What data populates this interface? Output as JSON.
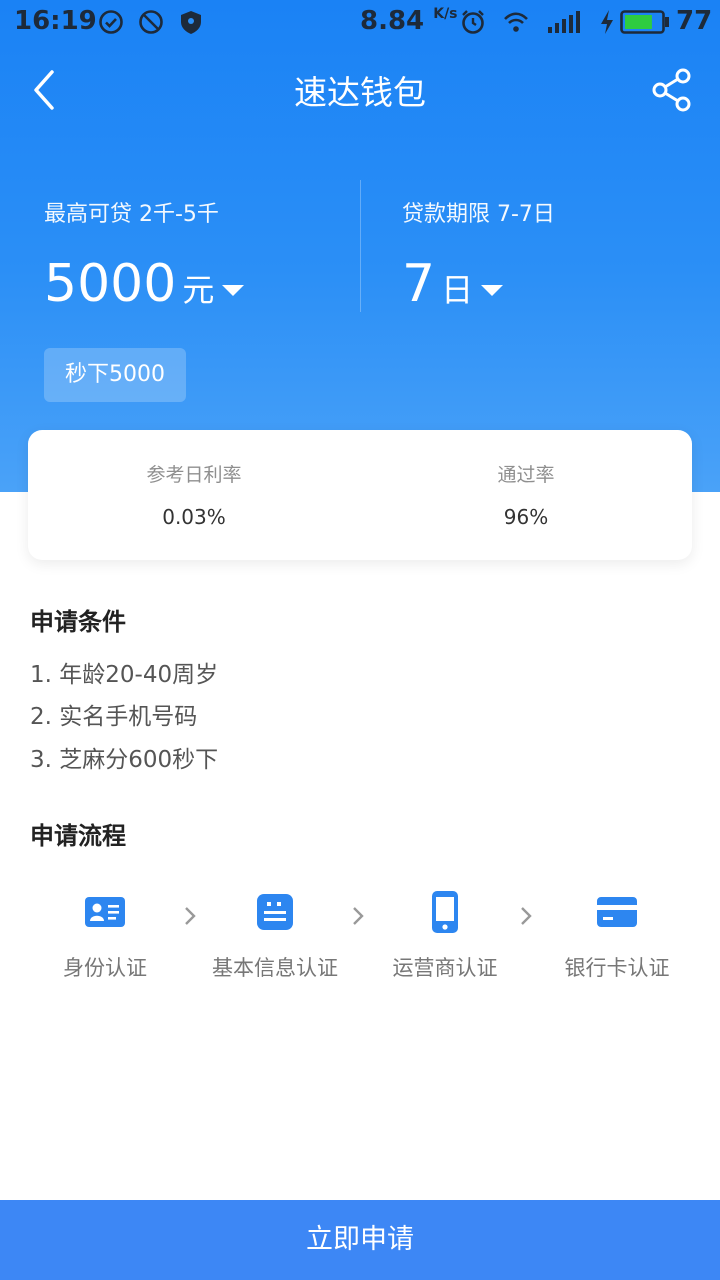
{
  "status_bar": {
    "time": "16:19",
    "speed_value": "8.84",
    "speed_unit": "K/s",
    "battery_level": "77",
    "icons": [
      "check-circle-icon",
      "no-entry-icon",
      "shield-icon",
      "alarm-icon",
      "wifi-icon",
      "signal-4g-icon",
      "charging-icon",
      "battery-icon"
    ]
  },
  "nav": {
    "title": "速达钱包",
    "back_icon": "chevron-left-icon",
    "share_icon": "share-icon"
  },
  "loan": {
    "amount_caption": "最高可贷 2千-5千",
    "amount_value": "5000",
    "amount_unit": "元",
    "term_caption": "贷款期限 7-7日",
    "term_value": "7",
    "term_unit": "日",
    "quick_tag": "秒下5000"
  },
  "stats": {
    "rate_label": "参考日利率",
    "rate_value": "0.03%",
    "pass_label": "通过率",
    "pass_value": "96%"
  },
  "conditions": {
    "title": "申请条件",
    "items": [
      "1. 年龄20-40周岁",
      "2. 实名手机号码",
      "3. 芝麻分600秒下"
    ]
  },
  "process": {
    "title": "申请流程",
    "steps": [
      {
        "label": "身份认证",
        "icon": "id-card-icon"
      },
      {
        "label": "基本信息认证",
        "icon": "info-list-icon"
      },
      {
        "label": "运营商认证",
        "icon": "phone-icon"
      },
      {
        "label": "银行卡认证",
        "icon": "bank-card-icon"
      }
    ]
  },
  "apply_button": "立即申请",
  "colors": {
    "primary": "#1a82f5",
    "button": "#3d87f5",
    "battery": "#2ecc40"
  }
}
